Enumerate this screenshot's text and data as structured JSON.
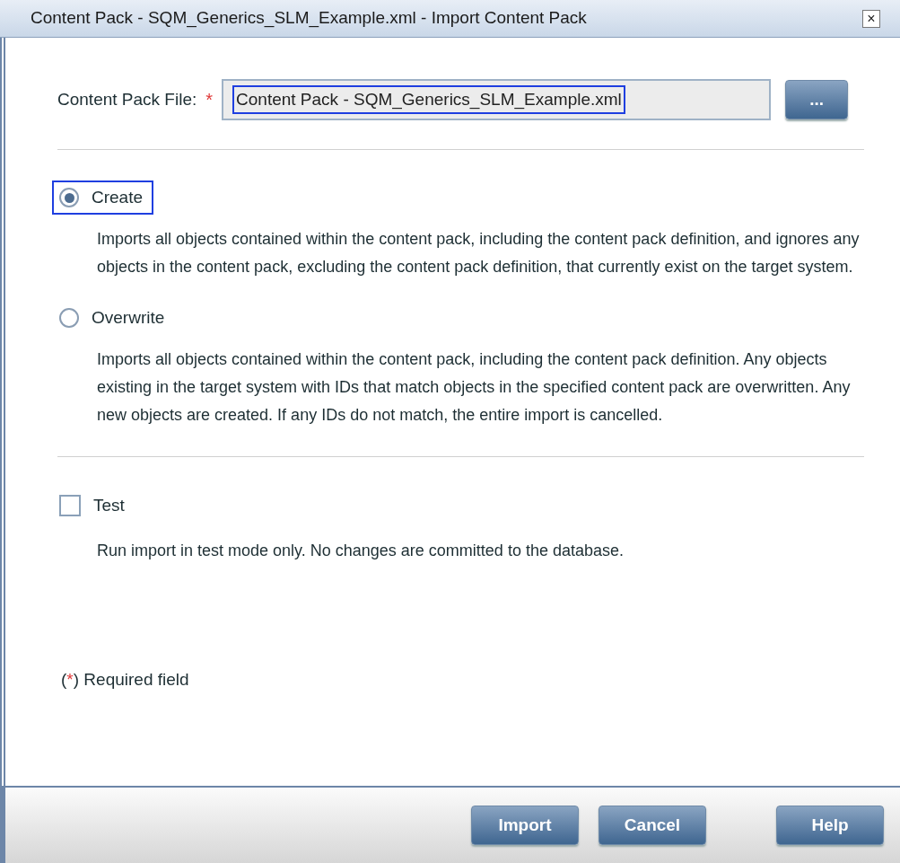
{
  "window": {
    "title": "Content Pack - SQM_Generics_SLM_Example.xml - Import Content Pack",
    "close": "×"
  },
  "file_field": {
    "label": "Content Pack File:",
    "required_mark": "*",
    "value": "Content Pack - SQM_Generics_SLM_Example.xml",
    "browse": "..."
  },
  "modes": [
    {
      "label": "Create",
      "selected": true,
      "focused": true,
      "description": "Imports all objects contained within the content pack, including the content pack definition, and ignores any objects in the content pack, excluding the content pack definition, that currently exist on the target system."
    },
    {
      "label": "Overwrite",
      "selected": false,
      "focused": false,
      "description": "Imports all objects contained within the content pack, including the content pack definition. Any objects existing in the target system with IDs that match objects in the specified content pack are overwritten. Any new objects are created. If any IDs do not match, the entire import is cancelled."
    }
  ],
  "test": {
    "label": "Test",
    "checked": false,
    "description": "Run import in test mode only. No changes are committed to the database."
  },
  "required_note": {
    "open": "(",
    "mark": "*",
    "text": ") Required field"
  },
  "buttons": [
    "Import",
    "Cancel",
    "Help"
  ]
}
